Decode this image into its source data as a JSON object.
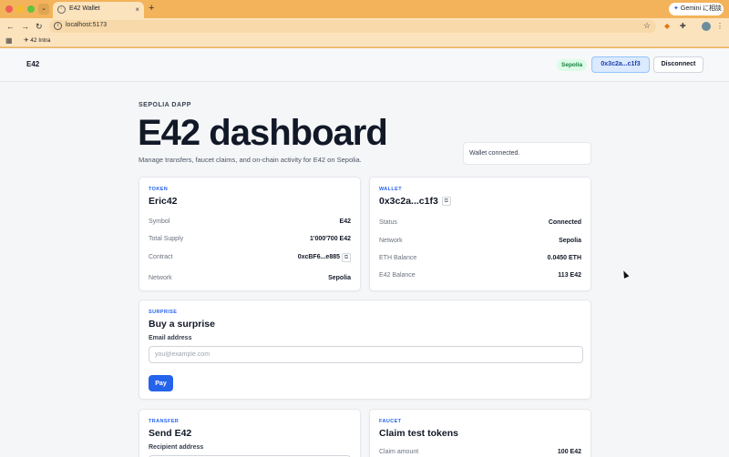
{
  "browser": {
    "tab_title": "E42 Wallet",
    "url": "localhost:5173",
    "bookmark": "42 Intra",
    "gemini_label": "Gemini に相談"
  },
  "header": {
    "brand": "E42",
    "network_badge": "Sepolia",
    "address_button": "0x3c2a...c1f3",
    "disconnect_button": "Disconnect"
  },
  "hero": {
    "eyebrow": "SEPOLIA DAPP",
    "title": "E42 dashboard",
    "subtitle": "Manage transfers, faucet claims, and on-chain activity for E42 on Sepolia.",
    "status": "Wallet connected."
  },
  "token_card": {
    "tag": "TOKEN",
    "title": "Eric42",
    "rows": [
      {
        "label": "Symbol",
        "value": "E42"
      },
      {
        "label": "Total Supply",
        "value": "1'000'700 E42"
      },
      {
        "label": "Contract",
        "value": "0xcBF6...e885"
      },
      {
        "label": "Network",
        "value": "Sepolia"
      }
    ]
  },
  "wallet_card": {
    "tag": "WALLET",
    "title": "0x3c2a...c1f3",
    "rows": [
      {
        "label": "Status",
        "value": "Connected"
      },
      {
        "label": "Network",
        "value": "Sepolia"
      },
      {
        "label": "ETH Balance",
        "value": "0.0450 ETH"
      },
      {
        "label": "E42 Balance",
        "value": "113 E42"
      }
    ]
  },
  "surprise_card": {
    "tag": "SURPRISE",
    "title": "Buy a surprise",
    "email_label": "Email address",
    "email_placeholder": "you@example.com",
    "pay_button": "Pay"
  },
  "transfer_card": {
    "tag": "TRANSFER",
    "title": "Send E42",
    "recipient_label": "Recipient address"
  },
  "faucet_card": {
    "tag": "FAUCET",
    "title": "Claim test tokens",
    "claim_label": "Claim amount",
    "claim_value": "100 E42"
  },
  "colors": {
    "accent": "#2563eb",
    "chrome": "#f3b35a",
    "success_bg": "#dcfce7",
    "success_text": "#15803d"
  }
}
